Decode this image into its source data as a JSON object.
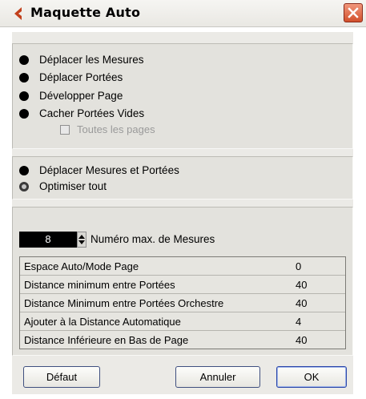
{
  "window": {
    "title": "Maquette Auto",
    "accent_color": "#c2401c"
  },
  "panel1": {
    "options": [
      {
        "label": "Déplacer les Mesures",
        "state": "selected"
      },
      {
        "label": "Déplacer Portées",
        "state": "selected"
      },
      {
        "label": "Développer Page",
        "state": "selected"
      },
      {
        "label": "Cacher Portées Vides",
        "state": "selected"
      }
    ],
    "checkbox": {
      "label": "Toutes les pages",
      "checked": false,
      "enabled": false
    }
  },
  "panel2": {
    "options": [
      {
        "label": "Déplacer Mesures et Portées",
        "state": "selected"
      },
      {
        "label": "Optimiser tout",
        "state": "ring"
      }
    ]
  },
  "panel3": {
    "max_measures_value": "8",
    "max_measures_label": "Numéro max. de Mesures",
    "table": [
      {
        "name": "Espace Auto/Mode Page",
        "value": "0"
      },
      {
        "name": "Distance minimum entre Portées",
        "value": "40"
      },
      {
        "name": "Distance Minimum entre Portées Orchestre",
        "value": "40"
      },
      {
        "name": "Ajouter à la Distance Automatique",
        "value": "4"
      },
      {
        "name": "Distance Inférieure en Bas de Page",
        "value": "40"
      }
    ]
  },
  "buttons": {
    "default": "Défaut",
    "cancel": "Annuler",
    "ok": "OK"
  },
  "icons": [
    "app-logo-icon",
    "close-icon",
    "spinner-up-icon",
    "spinner-down-icon"
  ]
}
